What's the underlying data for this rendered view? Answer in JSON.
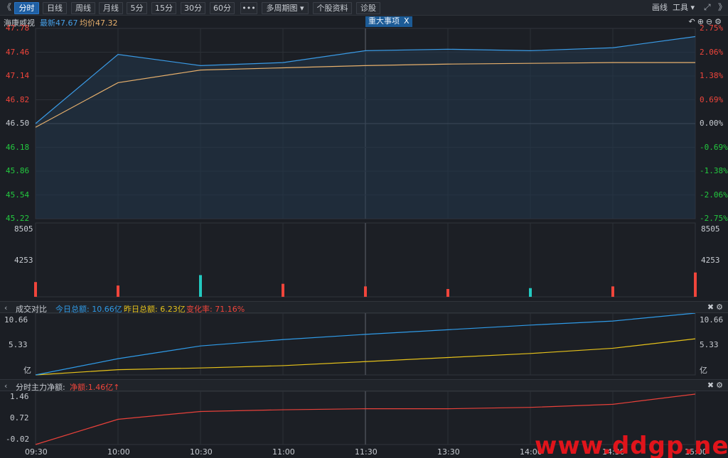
{
  "toolbar": {
    "back_glyph": "《",
    "tabs": [
      {
        "label": "分时",
        "active": true
      },
      {
        "label": "日线"
      },
      {
        "label": "周线"
      },
      {
        "label": "月线"
      },
      {
        "label": "5分"
      },
      {
        "label": "15分"
      },
      {
        "label": "30分"
      },
      {
        "label": "60分"
      },
      {
        "label": "•••"
      },
      {
        "label": "多周期图 ▾"
      },
      {
        "label": "个股资料"
      },
      {
        "label": "诊股"
      }
    ],
    "draw_label": "画线",
    "tools_label": "工具 ▾",
    "expand_icon": "expand-icon",
    "right_arrow": "》"
  },
  "quote": {
    "name": "海康威视",
    "last_label": "最新47.67",
    "avg_label": "均价47.32",
    "event_label": "重大事项",
    "event_close": "X"
  },
  "price_axis": {
    "left": [
      "47.78",
      "47.46",
      "47.14",
      "46.82",
      "46.50",
      "46.18",
      "45.86",
      "45.54",
      "45.22"
    ],
    "right": [
      "2.75%",
      "2.06%",
      "1.38%",
      "0.69%",
      "0.00%",
      "-0.69%",
      "-1.38%",
      "-2.06%",
      "-2.75%"
    ],
    "up_color": "#f0453b",
    "down_color": "#23c93f",
    "flat_color": "#c8ccd2"
  },
  "volume_axis": {
    "left": [
      "8505",
      "4253"
    ],
    "right": [
      "8505",
      "4253"
    ]
  },
  "compare_panel": {
    "title": "成交对比",
    "today_label": "今日总额: 10.66亿",
    "yesterday_label": "昨日总额: 6.23亿",
    "change_label": "变化率: 71.16%",
    "axis_left": [
      "10.66",
      "5.33",
      "亿"
    ],
    "axis_right": [
      "10.66",
      "5.33",
      "亿"
    ],
    "today_color": "#2f9be8",
    "yesterday_color": "#e6c21a"
  },
  "flow_panel": {
    "title": "分时主力净额:",
    "net_label": "净额:1.46亿↑",
    "axis_left": [
      "1.46",
      "0.72",
      "-0.02"
    ]
  },
  "time_axis": [
    "09:30",
    "10:00",
    "10:30",
    "11:00",
    "11:30",
    "13:30",
    "14:00",
    "14:30",
    "15:00"
  ],
  "chart_data": {
    "type": "line",
    "title": "",
    "xlabel": "",
    "ylabel": "",
    "x": [
      "09:30",
      "10:00",
      "10:30",
      "11:00",
      "11:30",
      "13:30",
      "14:00",
      "14:30",
      "15:00"
    ],
    "series": [
      {
        "name": "最新",
        "values": [
          46.5,
          47.43,
          47.28,
          47.32,
          47.48,
          47.5,
          47.48,
          47.52,
          47.67
        ]
      },
      {
        "name": "均价",
        "values": [
          46.45,
          47.05,
          47.22,
          47.25,
          47.28,
          47.3,
          47.31,
          47.32,
          47.32
        ]
      }
    ],
    "ylim": [
      45.22,
      47.78
    ],
    "volume": [
      1700,
      1300,
      2500,
      1500,
      1200,
      900,
      1000,
      1200,
      2800
    ],
    "volume_ylim": [
      0,
      8505
    ],
    "turnover_today": [
      0,
      2.8,
      5.0,
      6.1,
      7.0,
      7.8,
      8.6,
      9.3,
      10.66
    ],
    "turnover_yesterday": [
      0,
      0.9,
      1.2,
      1.6,
      2.3,
      3.0,
      3.7,
      4.6,
      6.23
    ],
    "turnover_ylim": [
      0,
      10.66
    ],
    "main_net_flow": [
      -0.02,
      0.72,
      0.95,
      1.0,
      1.03,
      1.03,
      1.07,
      1.16,
      1.46
    ],
    "main_net_flow_ylim": [
      -0.02,
      1.46
    ]
  },
  "watermark": "www.ddgp.net"
}
